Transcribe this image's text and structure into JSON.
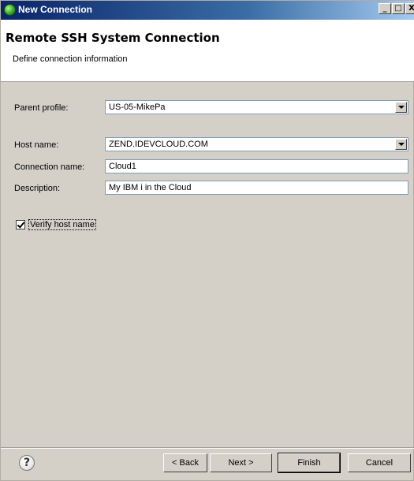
{
  "window": {
    "title": "New Connection",
    "buttons": {
      "minimize": "_",
      "maximize": "□",
      "close": "X"
    }
  },
  "header": {
    "title": "Remote SSH System Connection",
    "subtitle": "Define connection information"
  },
  "form": {
    "parent_profile": {
      "label": "Parent profile:",
      "value": "US-05-MikePa"
    },
    "host_name": {
      "label": "Host name:",
      "value": "ZEND.IDEVCLOUD.COM"
    },
    "connection_name": {
      "label": "Connection name:",
      "value": "Cloud1"
    },
    "description": {
      "label": "Description:",
      "value": "My IBM i in the Cloud"
    },
    "verify_host": {
      "label": "Verify host name",
      "checked": true
    }
  },
  "footer": {
    "help": "?",
    "back": "< Back",
    "next": "Next >",
    "finish": "Finish",
    "cancel": "Cancel"
  }
}
